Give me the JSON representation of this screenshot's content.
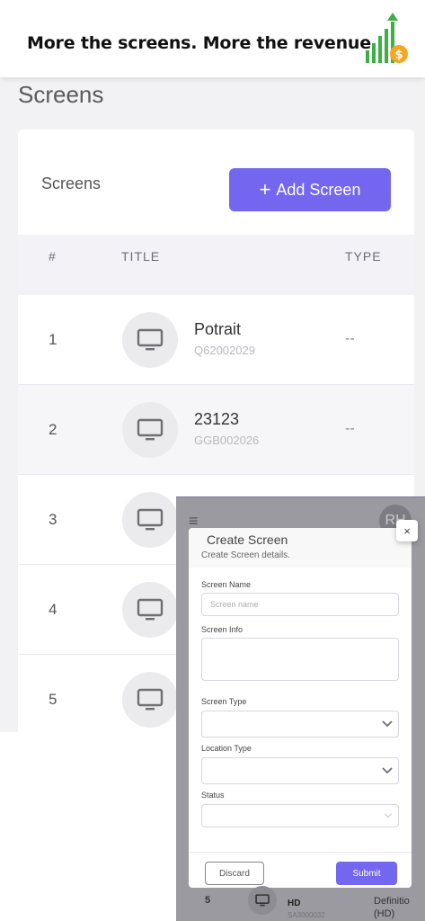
{
  "banner": {
    "text": "More the screens. More the revenue"
  },
  "colors": {
    "accent": "#7367f0",
    "growth_green": "#3cb043",
    "coin_orange": "#f5a623"
  },
  "page": {
    "title": "Screens"
  },
  "card": {
    "title": "Screens",
    "add_button": "Add Screen"
  },
  "table": {
    "headers": {
      "num": "#",
      "title": "TITLE",
      "type": "TYPE"
    },
    "rows": [
      {
        "num": "1",
        "name": "Potrait",
        "code": "Q62002029",
        "type": "--"
      },
      {
        "num": "2",
        "name": "23123",
        "code": "GGB002026",
        "type": "--"
      },
      {
        "num": "3"
      },
      {
        "num": "4"
      },
      {
        "num": "5"
      }
    ]
  },
  "overlay": {
    "avatar_initials": "RH",
    "row": {
      "num": "5",
      "name": "HD",
      "code": "SA3000032",
      "type_line1": "Definitio",
      "type_line2": "(HD)"
    }
  },
  "modal": {
    "title": "Create Screen",
    "subtitle": "Create Screen details.",
    "close_glyph": "×",
    "fields": {
      "screen_name_label": "Screen Name",
      "screen_name_placeholder": "Screen name",
      "screen_info_label": "Screen Info",
      "screen_type_label": "Screen Type",
      "location_type_label": "Location Type",
      "status_label": "Status"
    },
    "discard": "Discard",
    "submit": "Submit"
  },
  "icons": [
    "growth-chart-icon",
    "plus-icon",
    "monitor-icon",
    "hamburger-menu-icon",
    "close-icon",
    "chevron-down-icon"
  ]
}
